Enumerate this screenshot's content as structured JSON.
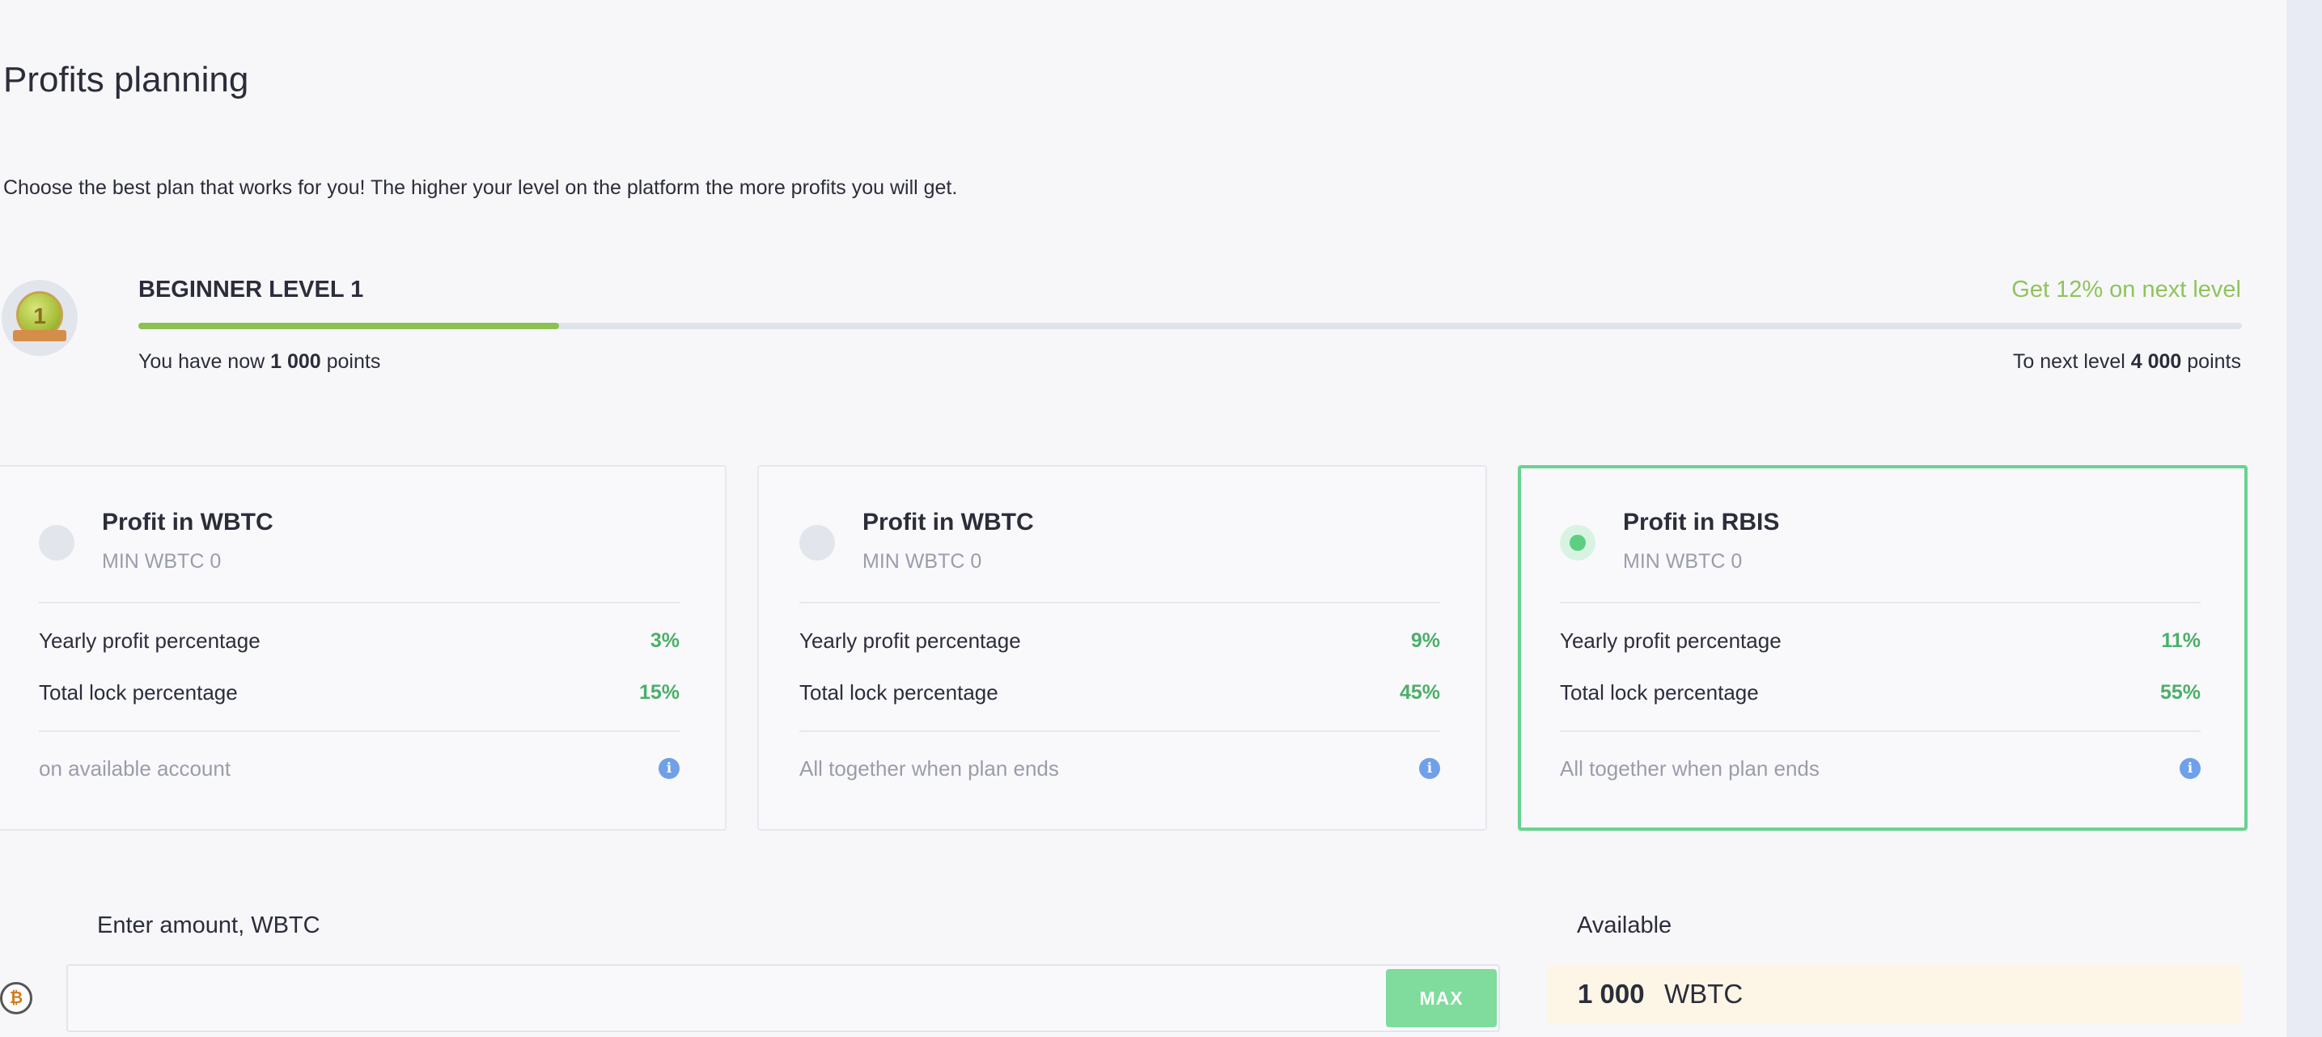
{
  "page": {
    "title": "Profits planning",
    "subtitle": "Choose the best plan that works for you! The higher your level on the platform the more profits you will get."
  },
  "level": {
    "badge_number": "1",
    "name": "BEGINNER LEVEL 1",
    "next_level_bonus": "Get 12% on next level",
    "progress_fraction": 0.2,
    "points_now_prefix": "You have now",
    "points_now_value": "1 000",
    "points_now_suffix": "points",
    "points_next_prefix": "To next level",
    "points_next_value": "4 000",
    "points_next_suffix": "points"
  },
  "plans": [
    {
      "title": "Profit in WBTC",
      "min": "MIN WBTC 0",
      "yearly_label": "Yearly profit percentage",
      "yearly_value": "3%",
      "lock_label": "Total lock percentage",
      "lock_value": "15%",
      "footer": "on available account",
      "selected": false
    },
    {
      "title": "Profit in WBTC",
      "min": "MIN WBTC 0",
      "yearly_label": "Yearly profit percentage",
      "yearly_value": "9%",
      "lock_label": "Total lock percentage",
      "lock_value": "45%",
      "footer": "All together when plan ends",
      "selected": false
    },
    {
      "title": "Profit in RBIS",
      "min": "MIN WBTC 0",
      "yearly_label": "Yearly profit percentage",
      "yearly_value": "11%",
      "lock_label": "Total lock percentage",
      "lock_value": "55%",
      "footer": "All together when plan ends",
      "selected": true
    }
  ],
  "amount": {
    "label": "Enter amount, WBTC",
    "coin_icon_glyph": "₿",
    "input_value": "",
    "max_label": "MAX"
  },
  "available": {
    "label": "Available",
    "amount": "1 000",
    "unit": "WBTC"
  },
  "colors": {
    "accent_green": "#68d391",
    "value_green": "#4caf68",
    "progress_green": "#8cc152",
    "info_blue": "#6fa0e8",
    "available_bg": "#fdf6e6"
  },
  "icons": {
    "info": "info-icon",
    "coin": "bitcoin-coin-icon",
    "level": "level-medal-icon"
  }
}
